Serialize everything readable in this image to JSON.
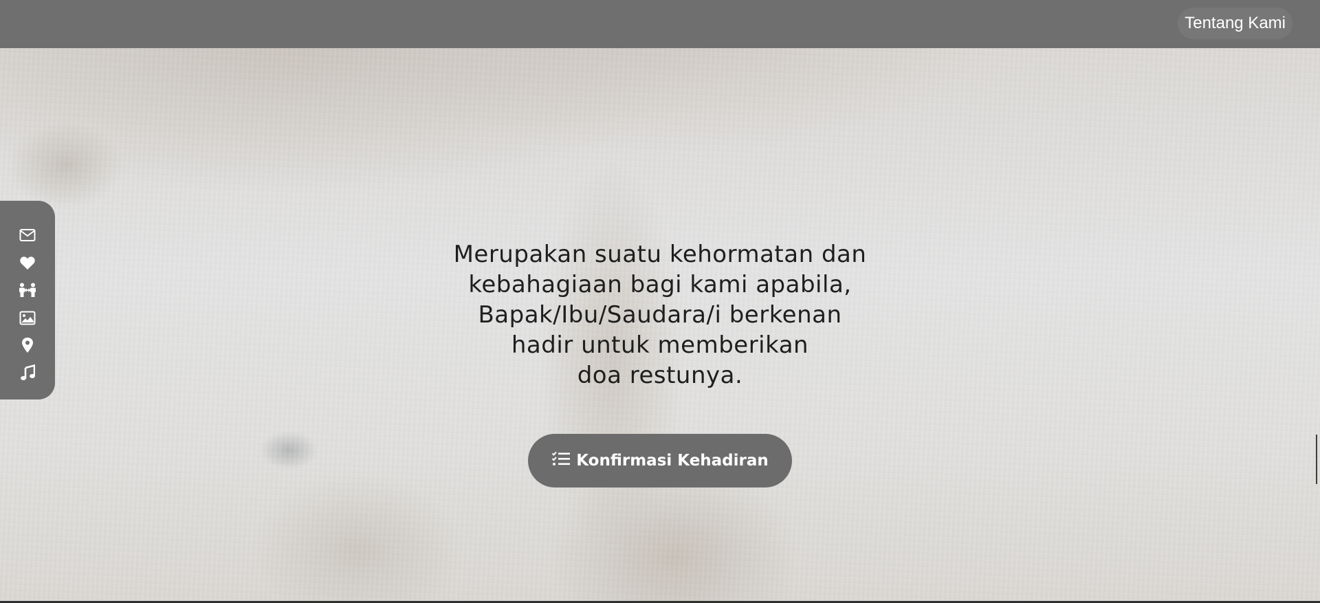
{
  "header": {
    "nav_link_label": "Tentang Kami"
  },
  "side_menu": {
    "items": [
      {
        "icon": "envelope-icon"
      },
      {
        "icon": "heart-icon"
      },
      {
        "icon": "couple-icon"
      },
      {
        "icon": "image-icon"
      },
      {
        "icon": "map-pin-icon"
      },
      {
        "icon": "music-icon"
      }
    ]
  },
  "main": {
    "message_lines": [
      "Merupakan suatu kehormatan dan",
      "kebahagiaan bagi kami apabila,",
      "Bapak/Ibu/Saudara/i berkenan",
      "hadir untuk memberikan",
      "doa restunya."
    ],
    "rsvp_button_label": "Konfirmasi Kehadiran",
    "rsvp_button_icon": "checklist-icon"
  },
  "colors": {
    "topbar": "#6f6f6f",
    "side_menu": "#6e6e6e",
    "button": "#6c6c6c",
    "text": "#1e1e1e"
  }
}
